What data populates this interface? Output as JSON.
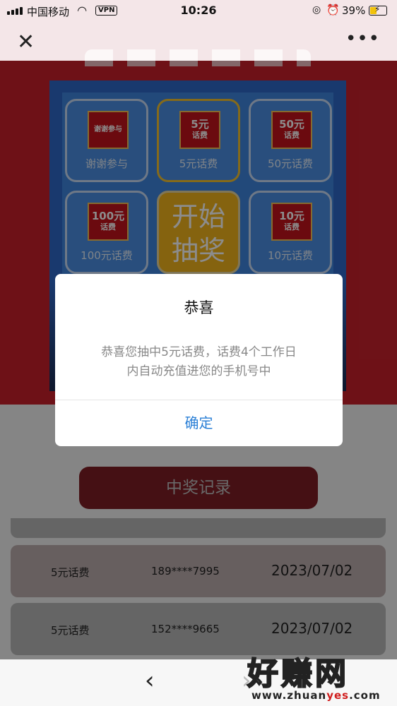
{
  "status_bar": {
    "carrier": "中国移动",
    "vpn": "VPN",
    "time": "10:26",
    "battery": "39%"
  },
  "nav": {
    "close_icon": "close-icon",
    "more_icon": "more-icon"
  },
  "grid": {
    "cells": [
      {
        "ticket_line1": "谢谢参与",
        "ticket_line2": "",
        "caption": "谢谢参与"
      },
      {
        "ticket_line1": "5元",
        "ticket_line2": "话费",
        "caption": "5元话费"
      },
      {
        "ticket_line1": "50元",
        "ticket_line2": "话费",
        "caption": "50元话费"
      },
      {
        "ticket_line1": "100元",
        "ticket_line2": "话费",
        "caption": "100元话费"
      },
      {
        "ticket_line1": "10元",
        "ticket_line2": "话费",
        "caption": "10元话费"
      }
    ],
    "start_label_1": "开始",
    "start_label_2": "抽奖"
  },
  "dialog": {
    "title": "恭喜",
    "message_line1": "恭喜您抽中5元话费，话费4个工作日",
    "message_line2": "内自动充值进您的手机号中",
    "ok_label": "确定"
  },
  "records_button": "中奖记录",
  "records": [
    {
      "prize": "5元话费",
      "phone": "189****7995",
      "date": "2023/07/02"
    },
    {
      "prize": "5元话费",
      "phone": "152****9665",
      "date": "2023/07/02"
    }
  ],
  "watermark": {
    "text": "好赚网",
    "url_pre": "www.zhuan",
    "url_mid": "yes",
    "url_post": ".com"
  }
}
